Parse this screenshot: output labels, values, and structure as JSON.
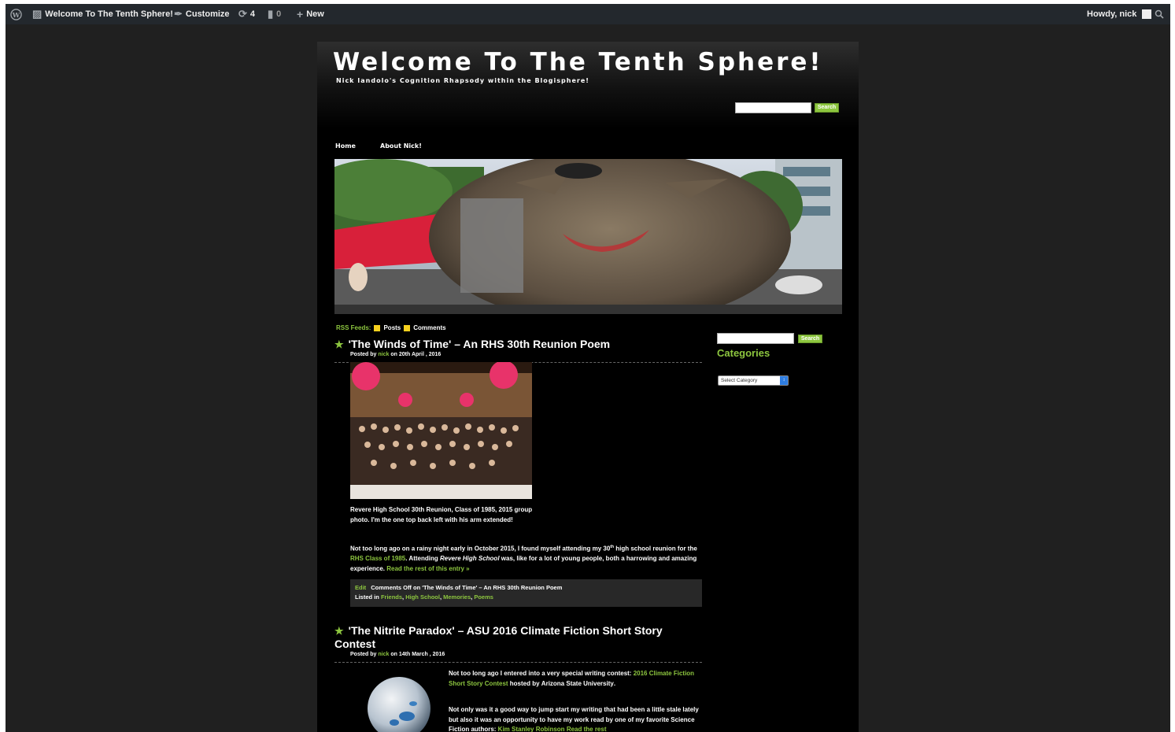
{
  "admin_bar": {
    "site_name": "Welcome To The Tenth Sphere!",
    "customize": "Customize",
    "updates_count": "4",
    "comments_count": "0",
    "new_label": "New",
    "greeting": "Howdy, nick"
  },
  "site": {
    "title": "Welcome To The Tenth Sphere!",
    "description": "Nick Iandolo's Cognition Rhapsody within the Blogisphere!",
    "search_button": "Search"
  },
  "nav": {
    "items": [
      {
        "label": "Home"
      },
      {
        "label": "About Nick!"
      }
    ]
  },
  "rss": {
    "label": "RSS Feeds:",
    "posts": "Posts",
    "comments": "Comments"
  },
  "posts": [
    {
      "title": "'The Winds of Time' – An RHS 30th Reunion Poem",
      "meta_prefix": "Posted by",
      "author": "nick",
      "meta_suffix": "on 20th April , 2016",
      "caption": "Revere High School 30th Reunion, Class of 1985, 2015 group photo. I'm the one top back left with his arm extended!",
      "excerpt_1": "Not too long ago on a rainy night early in October 2015, I found myself attending my 30",
      "excerpt_sup": "th",
      "excerpt_2": " high school reunion for the ",
      "excerpt_link": "RHS Class of 1985",
      "excerpt_3": ". Attending ",
      "excerpt_em": "Revere High School",
      "excerpt_4": " was, like for a lot of young people, both a harrowing and amazing experience. ",
      "read_more": "Read the rest of this entry »",
      "edit": "Edit",
      "comments_text": "Comments Off on 'The Winds of Time' – An RHS 30th Reunion Poem",
      "listed_in": "Listed in",
      "categories": [
        "Friends",
        "High School",
        "Memories",
        "Poems"
      ]
    },
    {
      "title": "'The Nitrite Paradox' – ASU 2016 Climate Fiction Short Story Contest",
      "meta_prefix": "Posted by",
      "author": "nick",
      "meta_suffix": "on 14th March , 2016",
      "p1_a": "Not too long ago I entered into a very special writing contest: ",
      "p1_link": "2016 Climate Fiction Short Story Contest",
      "p1_b": " hosted by ",
      "p1_strong": "Arizona State University",
      "p1_c": ".",
      "p2_a": "Not only was it a good way to jump start my writing that had been a little stale lately but also it was an opportunity to have my work read by one of my favorite Science Fiction authors: ",
      "p2_link": "Kim Stanley Robinson",
      "p2_more": "Read the rest"
    }
  ],
  "sidebar": {
    "search_button": "Search",
    "categories_title": "Categories",
    "select_placeholder": "Select Category"
  },
  "colors": {
    "accent": "#8dc63f",
    "page_bg": "#000000",
    "outer_bg": "#202020",
    "admin_bar": "#23282d"
  }
}
